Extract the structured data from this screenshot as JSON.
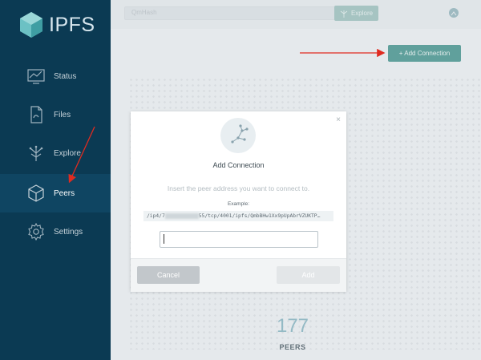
{
  "app": {
    "logo_text": "IPFS"
  },
  "sidebar": {
    "items": [
      {
        "label": "Status",
        "icon": "status-monitor-icon"
      },
      {
        "label": "Files",
        "icon": "files-document-icon"
      },
      {
        "label": "Explore",
        "icon": "explore-tree-icon"
      },
      {
        "label": "Peers",
        "icon": "peers-cube-icon",
        "active": true
      },
      {
        "label": "Settings",
        "icon": "settings-gear-icon"
      }
    ]
  },
  "topbar": {
    "search_placeholder": "QmHash",
    "explore_label": "Explore"
  },
  "main": {
    "add_connection_label": "+ Add Connection",
    "peer_count": "177",
    "peer_label": "PEERS"
  },
  "modal": {
    "close": "×",
    "title": "Add Connection",
    "subtitle": "Insert the peer address you want to connect to.",
    "example_label": "Example:",
    "example_prefix": "/ip4/7",
    "example_suffix": "55/tcp/4001/ipfs/QmbBHw1Xx9pUpAbrVZUKTP…",
    "input_value": "",
    "cancel_label": "Cancel",
    "add_label": "Add"
  },
  "colors": {
    "sidebar_bg": "#0b3a53",
    "accent_teal": "#1b7b73",
    "annotation_red": "#e02b20",
    "peer_count": "#6aa3b2"
  }
}
